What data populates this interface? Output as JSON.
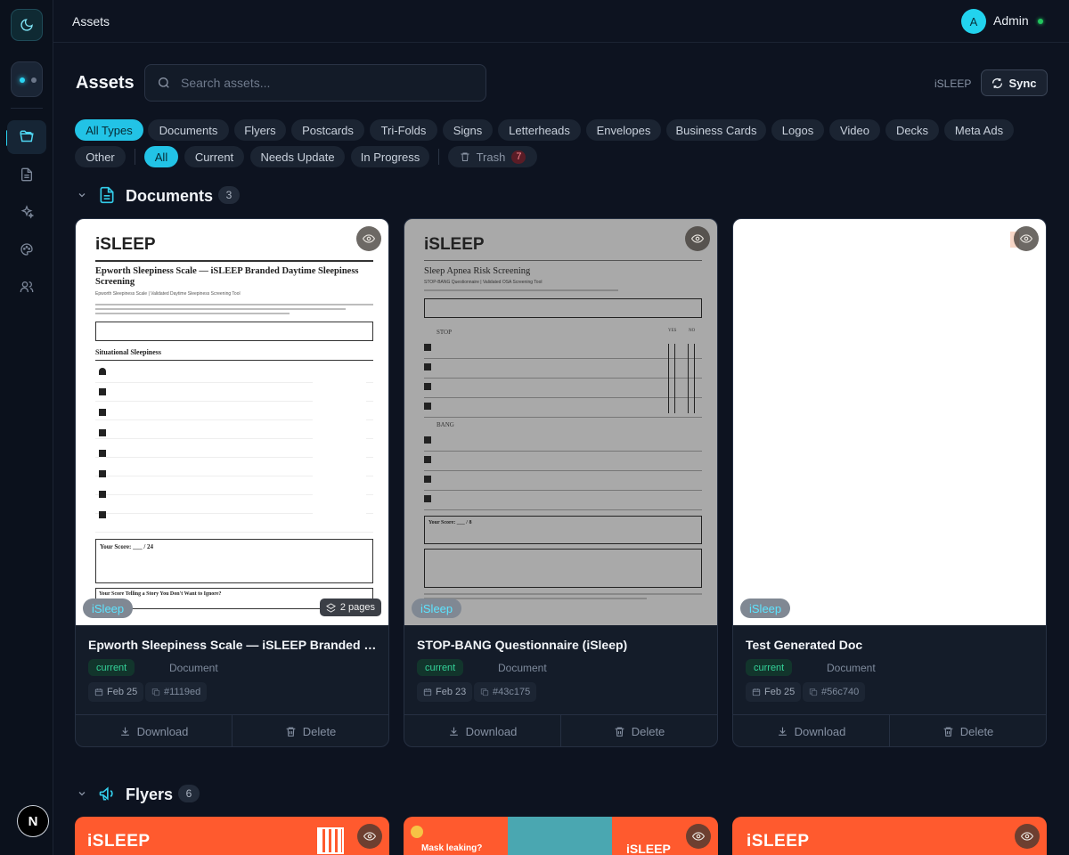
{
  "topbar": {
    "breadcrumb": "Assets",
    "user_initial": "A",
    "user_name": "Admin"
  },
  "header": {
    "title": "Assets",
    "search_placeholder": "Search assets...",
    "brand": "iSLEEP",
    "sync_label": "Sync"
  },
  "type_filters": [
    "All Types",
    "Documents",
    "Flyers",
    "Postcards",
    "Tri-Folds",
    "Signs",
    "Letterheads",
    "Envelopes",
    "Business Cards",
    "Logos",
    "Video",
    "Decks",
    "Meta Ads",
    "Other"
  ],
  "status_filters": [
    "All",
    "Current",
    "Needs Update",
    "In Progress"
  ],
  "trash": {
    "label": "Trash",
    "count": "7"
  },
  "sections": {
    "documents": {
      "title": "Documents",
      "count": "3"
    },
    "flyers": {
      "title": "Flyers",
      "count": "6"
    }
  },
  "cards": [
    {
      "brand": "iSleep",
      "pages": "2 pages",
      "title": "Epworth Sleepiness Scale — iSLEEP Branded D...",
      "status": "current",
      "type": "Document",
      "date": "Feb 25",
      "id": "#1119ed",
      "download": "Download",
      "delete": "Delete"
    },
    {
      "brand": "iSleep",
      "title": "STOP-BANG Questionnaire (iSleep)",
      "status": "current",
      "type": "Document",
      "date": "Feb 23",
      "id": "#43c175",
      "download": "Download",
      "delete": "Delete"
    },
    {
      "brand": "iSleep",
      "title": "Test Generated Doc",
      "status": "current",
      "type": "Document",
      "date": "Feb 25",
      "id": "#56c740",
      "download": "Download",
      "delete": "Delete"
    }
  ],
  "thumbs": {
    "doc1": {
      "logo": "iSLEEP",
      "title": "Epworth Sleepiness Scale — iSLEEP Branded Daytime Sleepiness Screening",
      "subtitle": "Epworth Sleepiness Scale | Validated Daytime Sleepiness Screening Tool",
      "section": "Situational Sleepiness",
      "score": "Your Score: ___ / 24",
      "footer": "Your Score Telling a Story You Don't Want to Ignore?"
    },
    "doc2": {
      "logo": "iSLEEP",
      "title": "Sleep Apnea Risk Screening",
      "subtitle": "STOP-BANG Questionnaire | Validated OSA Screening Tool",
      "stop": "STOP",
      "bang": "BANG",
      "yes": "YES",
      "no": "NO",
      "score": "Your Score: ___ / 8"
    },
    "flyer_logo": "iSLEEP",
    "flyer2_tag": "Mask leaking?"
  },
  "colors": {
    "accent": "#22c3e6",
    "flyer": "#ff5a2e",
    "status": "#34d399"
  }
}
